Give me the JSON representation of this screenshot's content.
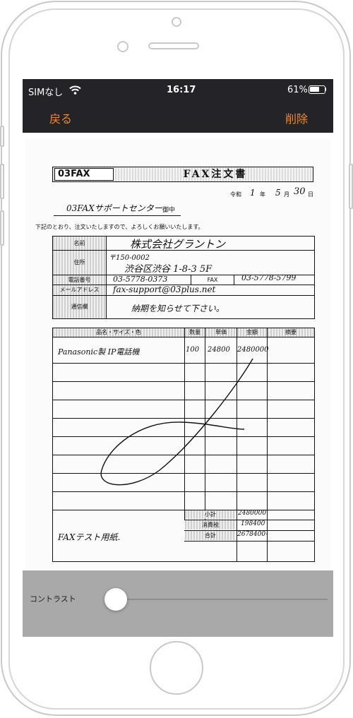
{
  "status_bar": {
    "carrier": "SIMなし",
    "time": "16:17",
    "battery": "61%"
  },
  "nav": {
    "back_label": "戻る",
    "delete_label": "削除"
  },
  "document": {
    "logo_text": "03FAX",
    "title": "FAX注文書",
    "date_era": "令和",
    "date_year": "1",
    "date_year_unit": "年",
    "date_month": "5",
    "date_month_unit": "月",
    "date_day": "30",
    "date_day_unit": "日",
    "recipient": "03FAXサポートセンター",
    "recipient_suffix": "御中",
    "intro": "下記のとおり、注文いたしますので、よろしくお願いいたします。",
    "labels": {
      "name": "名前",
      "address": "住所",
      "phone": "電話番号",
      "fax": "FAX",
      "email": "メールアドレス",
      "remarks": "通信欄"
    },
    "values": {
      "name": "株式会社グラントン",
      "postal": "〒150-0002",
      "address": "渋谷区渋谷 1-8-3 5F",
      "phone": "03-5778-0373",
      "fax": "03-5778-5799",
      "email": "fax-support@03plus.net",
      "remarks": "納期を知らせて下さい。"
    },
    "table_headers": {
      "item": "品名・サイズ・色",
      "qty": "数量",
      "unit_price": "単価",
      "amount": "金額",
      "note": "摘要"
    },
    "items": [
      {
        "item": "Panasonic製 IP電話機",
        "qty": "100",
        "unit_price": "24800",
        "amount": "2480000"
      }
    ],
    "totals": {
      "subtotal_label": "小計",
      "subtotal": "2480000",
      "tax_label": "消費税",
      "tax": "198400",
      "total_label": "合計",
      "total": "2678400-"
    },
    "footer_note": "FAXテスト用紙."
  },
  "controls": {
    "contrast_label": "コントラスト",
    "contrast_value": 0.05
  },
  "colors": {
    "accent": "#f0892a",
    "bar": "#232328",
    "panel": "#a9a9a9"
  }
}
